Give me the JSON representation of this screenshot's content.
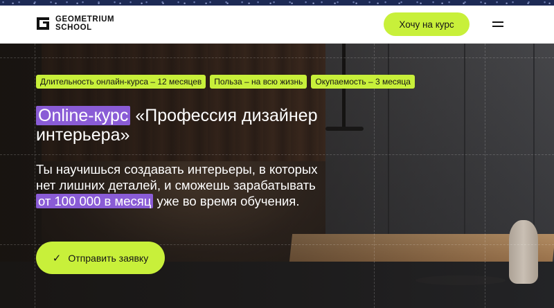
{
  "header": {
    "logo_line1": "GEOMETRIUM",
    "logo_line2": "SCHOOL",
    "cta_label": "Хочу на курс",
    "menu_icon": "hamburger-icon"
  },
  "hero": {
    "chips": [
      "Длительность онлайн-курса – 12 месяцев",
      "Польза – на всю жизнь",
      "Окупаемость – 3 месяца"
    ],
    "title_badge": "Online-курс",
    "title_rest": "«Профессия дизайнер интерьера»",
    "subtitle_part1": "Ты научишься создавать интерьеры, в которых нет лишних деталей, и сможешь зарабатывать",
    "subtitle_highlight": "от 100 000 в месяц",
    "subtitle_part2": "уже во время обучения.",
    "cta_label": "Отправить заявку",
    "cta_icon": "check-icon"
  },
  "colors": {
    "accent": "#c8f03a",
    "highlight": "#8a5cd6"
  }
}
